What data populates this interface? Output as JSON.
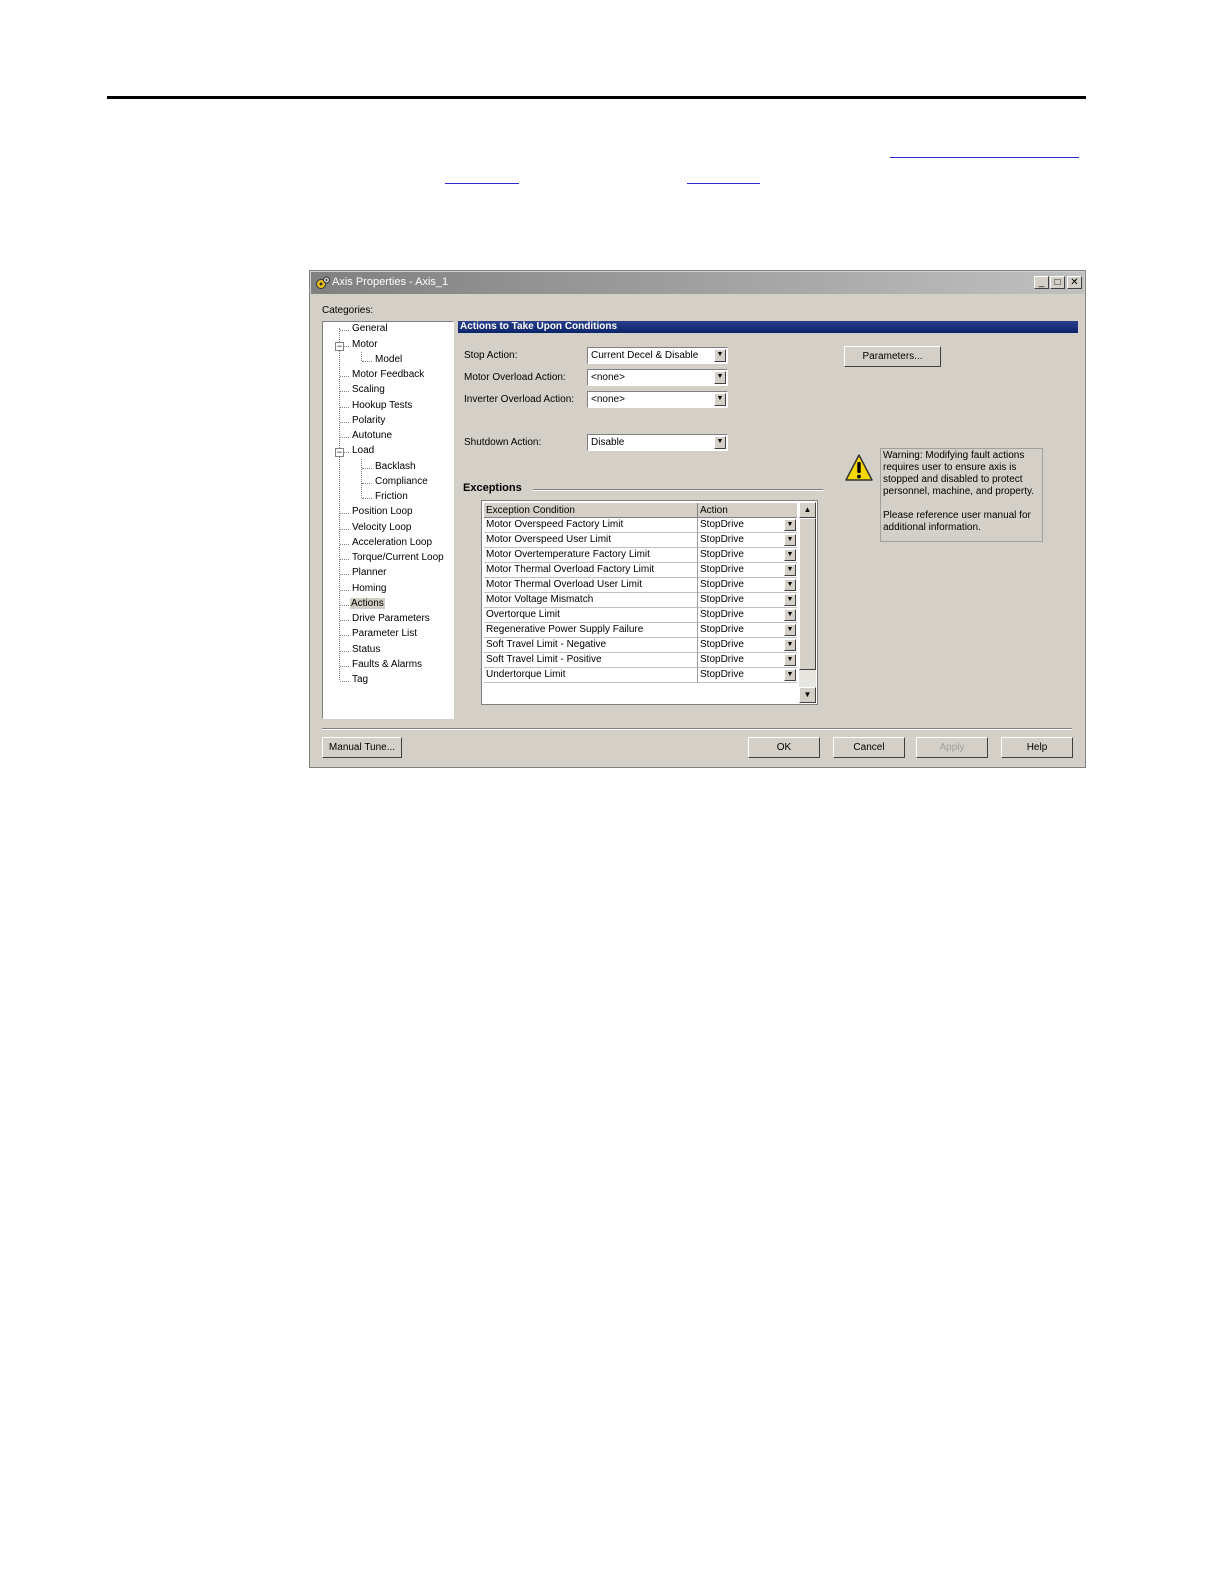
{
  "dialog": {
    "title": "Axis Properties - Axis_1",
    "categories_label": "Categories:"
  },
  "tree": {
    "items": [
      {
        "label": "General"
      },
      {
        "label": "Motor"
      },
      {
        "label": "Model"
      },
      {
        "label": "Motor Feedback"
      },
      {
        "label": "Scaling"
      },
      {
        "label": "Hookup Tests"
      },
      {
        "label": "Polarity"
      },
      {
        "label": "Autotune"
      },
      {
        "label": "Load"
      },
      {
        "label": "Backlash"
      },
      {
        "label": "Compliance"
      },
      {
        "label": "Friction"
      },
      {
        "label": "Position Loop"
      },
      {
        "label": "Velocity Loop"
      },
      {
        "label": "Acceleration Loop"
      },
      {
        "label": "Torque/Current Loop"
      },
      {
        "label": "Planner"
      },
      {
        "label": "Homing"
      },
      {
        "label": "Actions"
      },
      {
        "label": "Drive Parameters"
      },
      {
        "label": "Parameter List"
      },
      {
        "label": "Status"
      },
      {
        "label": "Faults & Alarms"
      },
      {
        "label": "Tag"
      }
    ],
    "selected": "Actions"
  },
  "panel": {
    "header": "Actions to Take Upon Conditions",
    "stop_action_label": "Stop Action:",
    "stop_action_value": "Current Decel & Disable",
    "motor_overload_label": "Motor Overload Action:",
    "motor_overload_value": "<none>",
    "inverter_overload_label": "Inverter Overload Action:",
    "inverter_overload_value": "<none>",
    "shutdown_label": "Shutdown Action:",
    "shutdown_value": "Disable",
    "parameters_button": "Parameters...",
    "exceptions_label": "Exceptions"
  },
  "exceptions": {
    "columns": [
      "Exception Condition",
      "Action"
    ],
    "rows": [
      {
        "condition": "Motor Overspeed Factory Limit",
        "action": "StopDrive"
      },
      {
        "condition": "Motor Overspeed User Limit",
        "action": "StopDrive"
      },
      {
        "condition": "Motor Overtemperature Factory Limit",
        "action": "StopDrive"
      },
      {
        "condition": "Motor Thermal Overload Factory Limit",
        "action": "StopDrive"
      },
      {
        "condition": "Motor Thermal Overload User Limit",
        "action": "StopDrive"
      },
      {
        "condition": "Motor Voltage Mismatch",
        "action": "StopDrive"
      },
      {
        "condition": "Overtorque Limit",
        "action": "StopDrive"
      },
      {
        "condition": "Regenerative Power Supply Failure",
        "action": "StopDrive"
      },
      {
        "condition": "Soft Travel Limit - Negative",
        "action": "StopDrive"
      },
      {
        "condition": "Soft Travel Limit - Positive",
        "action": "StopDrive"
      },
      {
        "condition": "Undertorque Limit",
        "action": "StopDrive"
      }
    ]
  },
  "warning": {
    "text1": "Warning: Modifying fault actions requires user to ensure axis is stopped and disabled to protect personnel, machine, and property.",
    "text2": "Please reference user manual for additional information."
  },
  "buttons": {
    "manual_tune": "Manual Tune...",
    "ok": "OK",
    "cancel": "Cancel",
    "apply": "Apply",
    "help": "Help"
  }
}
